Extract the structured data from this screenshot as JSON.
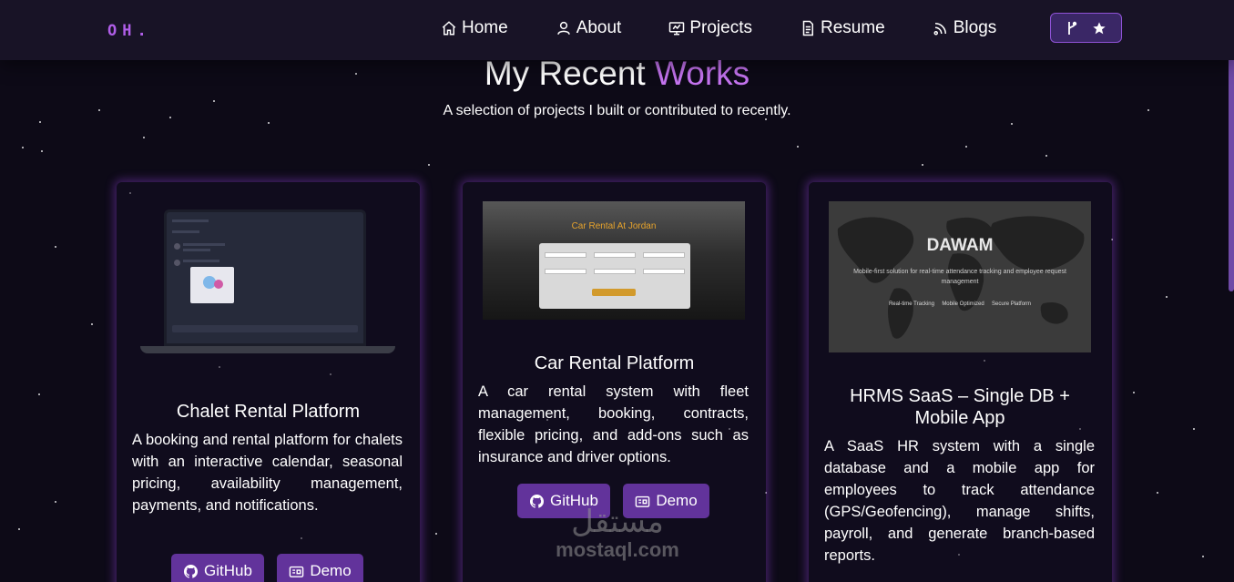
{
  "navbar": {
    "logo": "OH.",
    "links": [
      {
        "label": "Home",
        "icon": "home-icon"
      },
      {
        "label": "About",
        "icon": "user-icon"
      },
      {
        "label": "Projects",
        "icon": "projects-icon"
      },
      {
        "label": "Resume",
        "icon": "document-icon"
      },
      {
        "label": "Blogs",
        "icon": "blog-icon"
      }
    ],
    "star_button": {
      "icons": [
        "git-fork-icon",
        "star-icon"
      ]
    }
  },
  "section": {
    "title_prefix": "My Recent",
    "title_accent": "Works",
    "subtitle": "A selection of projects I built or contributed to recently."
  },
  "projects": [
    {
      "title": "Chalet Rental Platform",
      "description": "A booking and rental platform for chalets with an interactive calendar, seasonal pricing, availability management, payments, and notifications.",
      "github_label": "GitHub",
      "demo_label": "Demo"
    },
    {
      "title": "Car Rental Platform",
      "description": "A car rental system with fleet management, booking, contracts, flexible pricing, and add-ons such as insurance and driver options.",
      "github_label": "GitHub",
      "demo_label": "Demo",
      "image_title": "Car Rental At Jordan"
    },
    {
      "title": "HRMS SaaS – Single DB + Mobile App",
      "description": "A SaaS HR system with a single database and a mobile app for employees to track attendance (GPS/Geofencing), manage shifts, payroll, and generate branch-based reports.",
      "image_title": "DAWAM",
      "image_subtitle": "Mobile-first solution for real-time attendance tracking and employee request management",
      "image_features": [
        "Real-time Tracking",
        "Mobile Optimized",
        "Secure Platform"
      ]
    }
  ],
  "watermark": {
    "arabic": "مستقل",
    "latin": "mostaql.com"
  },
  "colors": {
    "accent": "#c574f0",
    "button": "#62339b",
    "background": "#0d0a17",
    "navbar": "#181326"
  }
}
